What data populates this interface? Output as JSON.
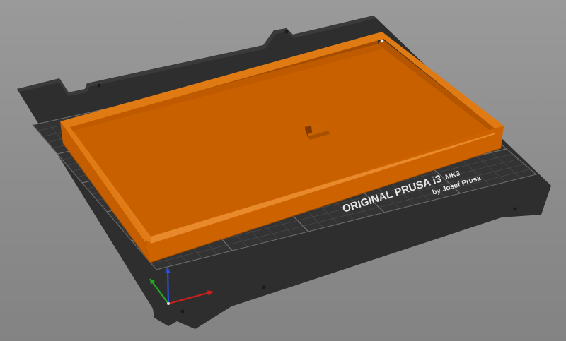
{
  "app": {
    "viewport": "3D plater view"
  },
  "bed": {
    "brand_line": "ORIGINAL PRUSA i3",
    "brand_model": "MK3",
    "brand_byline": "by Josef Prusa",
    "colors": {
      "plate": "#2f2f2f",
      "grid_minor": "#4a4a4a",
      "grid_major": "#777777",
      "text": "#e6e6e6"
    }
  },
  "model": {
    "name": "orange-tray",
    "color": "#d46a00",
    "selected": false
  },
  "axes": {
    "x_color": "#cc1f1f",
    "y_color": "#22aa22",
    "z_color": "#2a4dd6"
  }
}
